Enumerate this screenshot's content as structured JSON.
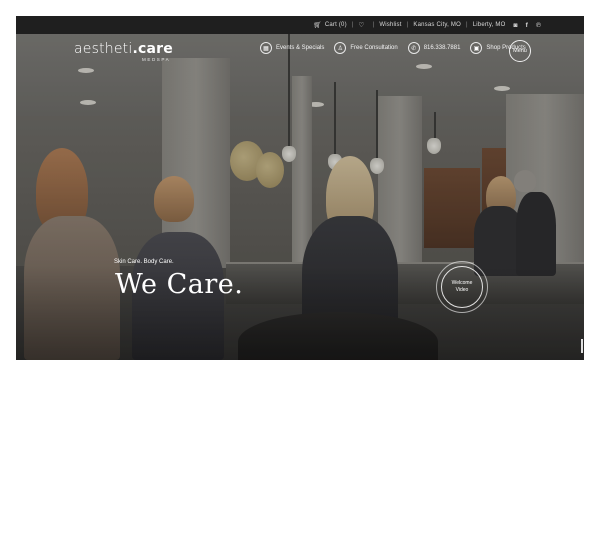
{
  "topbar": {
    "cart": "Cart (0)",
    "wishlist": "Wishlist",
    "location_1": "Kansas City, MO",
    "location_2": "Liberty, MO",
    "social_icons": [
      "instagram-icon",
      "facebook-icon",
      "pinterest-icon"
    ]
  },
  "brand": {
    "logo_text_light": "aestheti",
    "logo_text_bold": ".care",
    "logo_sub": "MEDSPA"
  },
  "nav": {
    "items": [
      {
        "label": "Events & Specials",
        "icon": "calendar-icon"
      },
      {
        "label": "Free Consultation",
        "icon": "user-icon"
      },
      {
        "label": "816.338.7881",
        "icon": "phone-icon"
      },
      {
        "label": "Shop Products",
        "icon": "shop-icon"
      }
    ],
    "menu_label": "Menu"
  },
  "hero": {
    "tagline": "Skin Care. Body Care.",
    "headline": "We Care.",
    "video_line_1": "Welcome",
    "video_line_2": "Video"
  },
  "colors": {
    "topbar_bg": "#1f1f1f",
    "text": "#ffffff",
    "page_bg": "#ffffff"
  }
}
